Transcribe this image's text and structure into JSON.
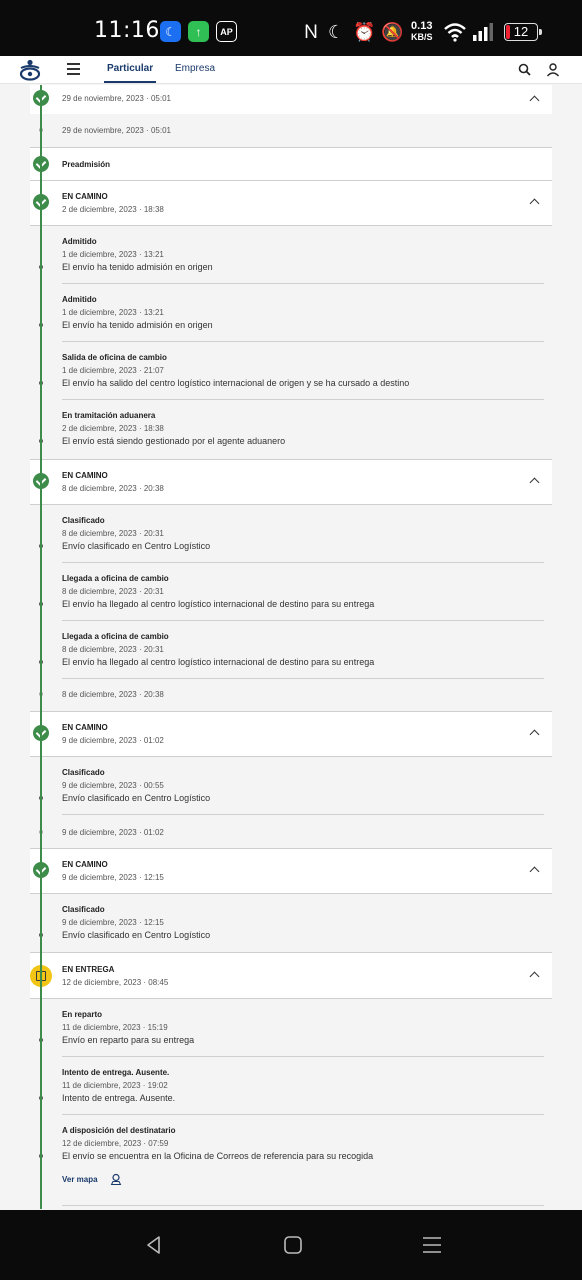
{
  "status_bar": {
    "time": "11:16",
    "app3_label": "AP",
    "net_speed": "0.13",
    "net_unit": "KB/S",
    "battery": "12"
  },
  "header": {
    "tabs": [
      {
        "label": "Particular",
        "active": true
      },
      {
        "label": "Empresa",
        "active": false
      }
    ],
    "accent_color": "#1a3a6b"
  },
  "timeline": {
    "top": {
      "date": "29 de noviembre, 2023 · 05:01"
    },
    "top_sub": {
      "date": "29 de noviembre, 2023 · 05:01"
    },
    "preadmision": {
      "title": "Preadmisión"
    },
    "groups": [
      {
        "status": "EN CAMINO",
        "date": "2 de diciembre, 2023 · 18:38",
        "events": [
          {
            "title": "Admitido",
            "date": "1 de diciembre, 2023 · 13:21",
            "desc": "El envío ha tenido admisión en origen"
          },
          {
            "title": "Admitido",
            "date": "1 de diciembre, 2023 · 13:21",
            "desc": "El envío ha tenido admisión en origen"
          },
          {
            "title": "Salida de oficina de cambio",
            "date": "1 de diciembre, 2023 · 21:07",
            "desc": "El envío ha salido del centro logístico internacional de origen y se ha cursado a destino"
          },
          {
            "title": "En tramitación aduanera",
            "date": "2 de diciembre, 2023 · 18:38",
            "desc": "El envío está siendo gestionado por el agente aduanero"
          }
        ]
      },
      {
        "status": "EN CAMINO",
        "date": "8 de diciembre, 2023 · 20:38",
        "events": [
          {
            "title": "Clasificado",
            "date": "8 de diciembre, 2023 · 20:31",
            "desc": "Envío clasificado en Centro Logístico"
          },
          {
            "title": "Llegada a oficina de cambio",
            "date": "8 de diciembre, 2023 · 20:31",
            "desc": "El envío ha llegado al centro logístico internacional de destino para su entrega"
          },
          {
            "title": "Llegada a oficina de cambio",
            "date": "8 de diciembre, 2023 · 20:31",
            "desc": "El envío ha llegado al centro logístico internacional de destino para su entrega"
          }
        ],
        "trailing_date": "8 de diciembre, 2023 · 20:38"
      },
      {
        "status": "EN CAMINO",
        "date": "9 de diciembre, 2023 · 01:02",
        "events": [
          {
            "title": "Clasificado",
            "date": "9 de diciembre, 2023 · 00:55",
            "desc": "Envío clasificado en Centro Logístico"
          }
        ],
        "trailing_date": "9 de diciembre, 2023 · 01:02"
      },
      {
        "status": "EN CAMINO",
        "date": "9 de diciembre, 2023 · 12:15",
        "events": [
          {
            "title": "Clasificado",
            "date": "9 de diciembre, 2023 · 12:15",
            "desc": "Envío clasificado en Centro Logístico"
          }
        ]
      },
      {
        "status": "EN ENTREGA",
        "date": "12 de diciembre, 2023 · 08:45",
        "events": [
          {
            "title": "En reparto",
            "date": "11 de diciembre, 2023 · 15:19",
            "desc": "Envío en reparto para su entrega"
          },
          {
            "title": "Intento de entrega. Ausente.",
            "date": "11 de diciembre, 2023 · 19:02",
            "desc": "Intento de entrega. Ausente."
          },
          {
            "title": "A disposición del destinatario",
            "date": "12 de diciembre, 2023 · 07:59",
            "desc": "El envío se encuentra en la Oficina de Correos de referencia para su recogida"
          }
        ],
        "map_link": "Ver mapa"
      }
    ],
    "colors": {
      "done": "#3e8c4a",
      "current": "#f1c515"
    }
  }
}
